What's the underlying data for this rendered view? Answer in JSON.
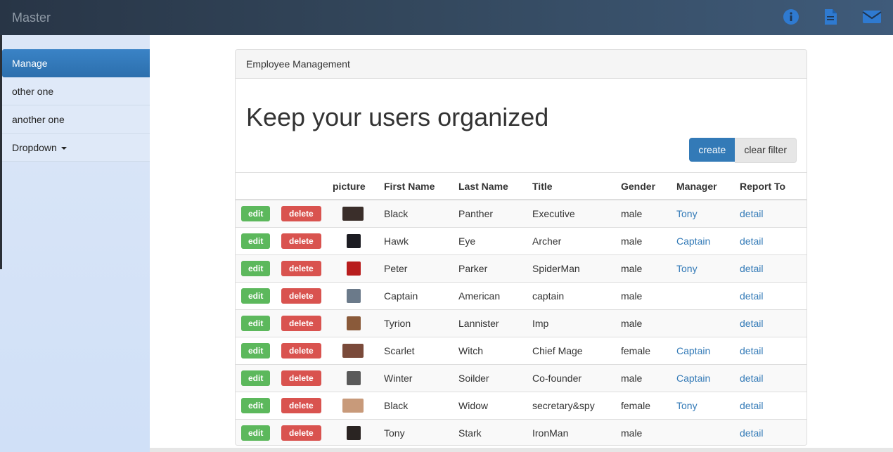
{
  "app": {
    "title": "Master"
  },
  "colors": {
    "primary": "#337ab7",
    "success": "#5cb85c",
    "danger": "#d9534f",
    "topbar": "#33475c"
  },
  "topbar": {
    "icons": [
      "info-circle-icon",
      "file-icon",
      "envelope-icon"
    ]
  },
  "sidebar": {
    "items": [
      {
        "label": "Manage",
        "active": true
      },
      {
        "label": "other one"
      },
      {
        "label": "another one"
      },
      {
        "label": "Dropdown",
        "has_caret": true
      }
    ]
  },
  "panel": {
    "heading": "Employee Management",
    "headline": "Keep your users organized",
    "create_label": "create",
    "clear_label": "clear filter"
  },
  "table": {
    "columns": [
      "",
      "",
      "picture",
      "First Name",
      "Last Name",
      "Title",
      "Gender",
      "Manager",
      "Report To"
    ],
    "edit_label": "edit",
    "delete_label": "delete",
    "rows": [
      {
        "first": "Black",
        "last": "Panther",
        "title": "Executive",
        "gender": "male",
        "manager": "Tony",
        "report": "detail",
        "avatar": "#3a2e2a",
        "avatar_wide": true
      },
      {
        "first": "Hawk",
        "last": "Eye",
        "title": "Archer",
        "gender": "male",
        "manager": "Captain",
        "report": "detail",
        "avatar": "#1c1c22"
      },
      {
        "first": "Peter",
        "last": "Parker",
        "title": "SpiderMan",
        "gender": "male",
        "manager": "Tony",
        "report": "detail",
        "avatar": "#b81d1d"
      },
      {
        "first": "Captain",
        "last": "American",
        "title": "captain",
        "gender": "male",
        "manager": "",
        "report": "detail",
        "avatar": "#6b7a8a"
      },
      {
        "first": "Tyrion",
        "last": "Lannister",
        "title": "Imp",
        "gender": "male",
        "manager": "",
        "report": "detail",
        "avatar": "#8a5a3a"
      },
      {
        "first": "Scarlet",
        "last": "Witch",
        "title": "Chief Mage",
        "gender": "female",
        "manager": "Captain",
        "report": "detail",
        "avatar": "#7a4a3a",
        "avatar_wide": true
      },
      {
        "first": "Winter",
        "last": "Soilder",
        "title": "Co-founder",
        "gender": "male",
        "manager": "Captain",
        "report": "detail",
        "avatar": "#5a5a5a"
      },
      {
        "first": "Black",
        "last": "Widow",
        "title": "secretary&spy",
        "gender": "female",
        "manager": "Tony",
        "report": "detail",
        "avatar": "#c89a7a",
        "avatar_wide": true
      },
      {
        "first": "Tony",
        "last": "Stark",
        "title": "IronMan",
        "gender": "male",
        "manager": "",
        "report": "detail",
        "avatar": "#2a2422"
      }
    ]
  }
}
